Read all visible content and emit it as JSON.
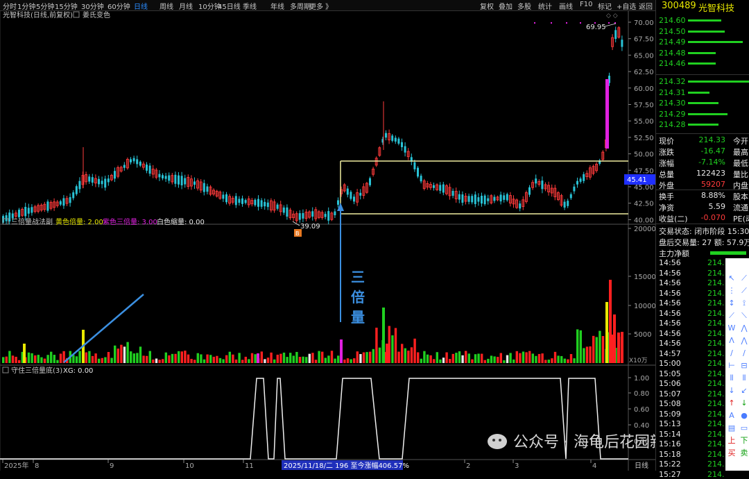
{
  "toolbar": {
    "periods": [
      "分时",
      "1分钟",
      "5分钟",
      "15分钟",
      "30分钟",
      "60分钟",
      "日线",
      "周线",
      "月线",
      "10分钟",
      "45日线",
      "季线",
      "年线",
      "多周期",
      "更多 》"
    ],
    "active_period": "日线",
    "right_tools": [
      "复权",
      "叠加",
      "多股",
      "统计",
      "画线",
      "F10",
      "标记",
      "+自选",
      "返回"
    ]
  },
  "main_panel": {
    "title": "光智科技(日线,前复权)",
    "indicator_name": "姜氏变色",
    "price_ticks": [
      "70.00",
      "67.50",
      "65.00",
      "62.50",
      "60.00",
      "57.50",
      "55.00",
      "52.50",
      "50.00",
      "47.50",
      "45.00",
      "42.50",
      "40.00"
    ],
    "high_label": "69.95",
    "low_label": "39.09",
    "current_price_tag": "45.41",
    "marker_glyph": "B"
  },
  "volume_panel": {
    "title": "三倍量战法副",
    "yellow_label": "黄色倍量: 2.00",
    "magenta_label": "紫色三倍量: 3.00",
    "white_label": "白色缩量: 0.00",
    "ticks": [
      "20000",
      "15000",
      "10000",
      "5000"
    ],
    "unit": "X10万",
    "annotation": "三倍量"
  },
  "xg_panel": {
    "title": "守住三倍量底(3)",
    "xg_label": "XG: 0.00",
    "ticks": [
      "1.00",
      "0.80",
      "0.60",
      "0.40",
      "0.20"
    ]
  },
  "date_axis": {
    "labels": [
      "2025年",
      "8",
      "9",
      "10",
      "11",
      "2",
      "3",
      "4"
    ],
    "highlight": "2025/11/18/二 196 至今涨幅406.57%",
    "period_label": "日线"
  },
  "stock": {
    "code": "300489",
    "name": "光智科技",
    "sell_prices": [
      "214.60",
      "214.50",
      "214.49",
      "214.48",
      "214.46"
    ],
    "buy_prices": [
      "214.32",
      "214.31",
      "214.30",
      "214.29",
      "214.28"
    ],
    "sell_bars": [
      0.55,
      0.6,
      0.9,
      0.45,
      0.45
    ],
    "buy_bars": [
      1.0,
      0.35,
      0.5,
      0.65,
      0.5
    ]
  },
  "quote": [
    {
      "label": "现价",
      "value": "214.33",
      "label2": "今开"
    },
    {
      "label": "涨跌",
      "value": "-16.47",
      "label2": "最高"
    },
    {
      "label": "涨幅",
      "value": "-7.14%",
      "label2": "最低"
    },
    {
      "label": "总量",
      "value": "122423",
      "label2": "量比"
    },
    {
      "label": "外盘",
      "value": "59207",
      "label2": "内盘"
    }
  ],
  "quote2": [
    {
      "label": "换手",
      "value": "8.88%",
      "label2": "股本"
    },
    {
      "label": "净资",
      "value": "5.59",
      "label2": "流通"
    },
    {
      "label": "收益(二)",
      "value": "-0.070",
      "label2": "PE(动"
    }
  ],
  "status": {
    "line1": "交易状态: 闭市阶段  15:30",
    "line2": "盘后交易量: 27  额: 57.9万",
    "net_label": "主力净额"
  },
  "ticks_list": [
    {
      "time": "14:56",
      "price": "214."
    },
    {
      "time": "14:56",
      "price": "214."
    },
    {
      "time": "14:56",
      "price": "214."
    },
    {
      "time": "14:56",
      "price": "214."
    },
    {
      "time": "14:56",
      "price": "214."
    },
    {
      "time": "14:56",
      "price": "214."
    },
    {
      "time": "14:56",
      "price": "214."
    },
    {
      "time": "14:56",
      "price": "214."
    },
    {
      "time": "14:56",
      "price": "214."
    },
    {
      "time": "14:57",
      "price": "214."
    },
    {
      "time": "15:00",
      "price": "214."
    },
    {
      "time": "15:05",
      "price": "214."
    },
    {
      "time": "15:06",
      "price": "214."
    },
    {
      "time": "15:07",
      "price": "214."
    },
    {
      "time": "15:08",
      "price": "214."
    },
    {
      "time": "15:09",
      "price": "214."
    },
    {
      "time": "15:13",
      "price": "214."
    },
    {
      "time": "15:14",
      "price": "214."
    },
    {
      "time": "15:16",
      "price": "214."
    },
    {
      "time": "15:18",
      "price": "214."
    },
    {
      "time": "15:22",
      "price": "214."
    },
    {
      "time": "15:27",
      "price": "214."
    }
  ],
  "tool_glyphs": [
    "↖",
    "⟋",
    "⋮",
    "⟋",
    "↕",
    "⟟",
    "⟋",
    "⟍",
    "W",
    "⋀",
    "Λ",
    "⋀",
    "∕",
    "∕",
    "⊢",
    "⊟",
    "⦀",
    "⦀",
    "↓",
    "↙",
    "↑",
    "↓",
    "A",
    "●",
    "▤",
    "▭",
    "上",
    "下",
    "买",
    "卖"
  ],
  "watermark": "公众号 · 海龟后花园新",
  "colors": {
    "up": "#ff3b3b",
    "down": "#29c3d6",
    "yellow": "#e8e800",
    "magenta": "#e020e0",
    "green": "#20d020",
    "box": "#f0eda0",
    "arrow": "#3b8fe0"
  }
}
